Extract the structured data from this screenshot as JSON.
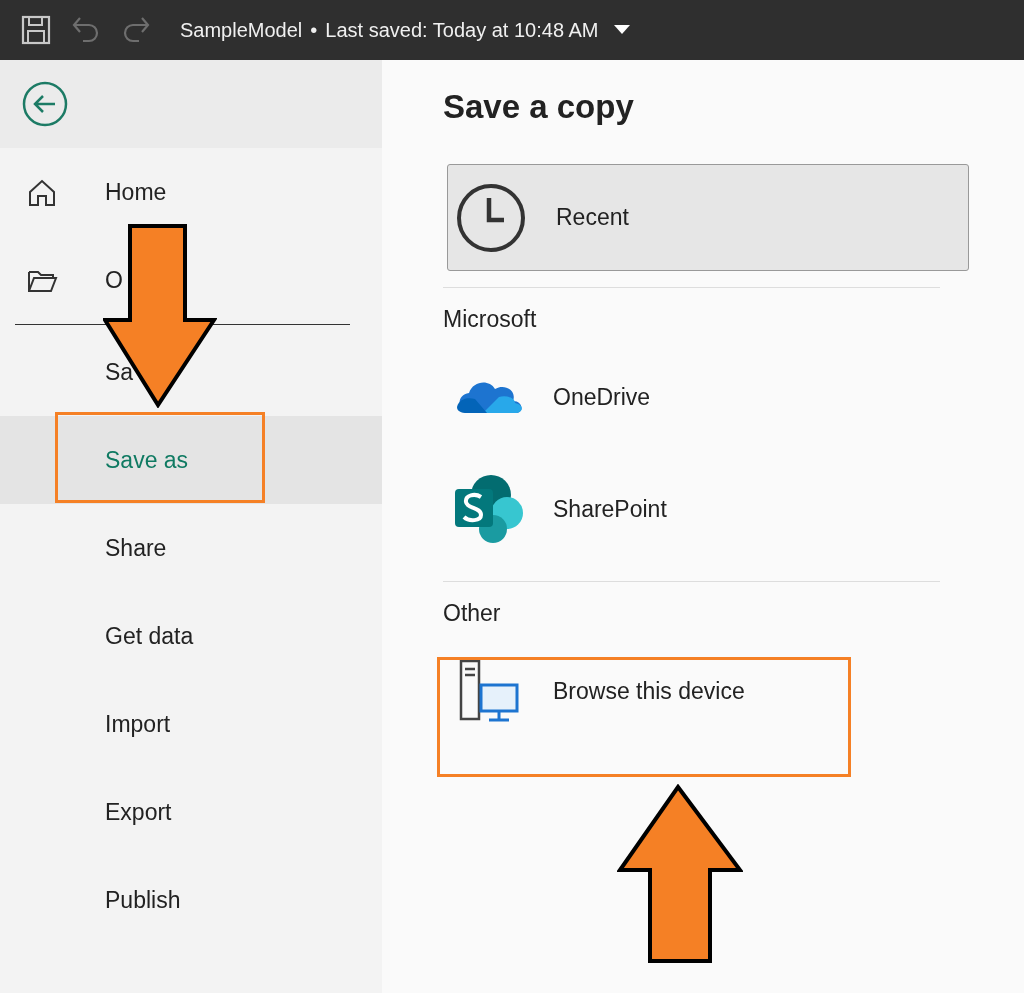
{
  "title_bar": {
    "tools": [
      {
        "kind": "save",
        "disabled": false
      },
      {
        "kind": "undo",
        "disabled": true
      },
      {
        "kind": "redo",
        "disabled": true
      }
    ],
    "file_name": "SampleModel",
    "separator": "•",
    "status": "Last saved: Today at 10:48 AM"
  },
  "sidebar": {
    "primary": [
      {
        "label": "Home",
        "kind": "home",
        "selected": false
      },
      {
        "label": "O",
        "kind": "folder",
        "selected": false
      }
    ],
    "secondary": [
      {
        "label": "Sa",
        "selected": false
      },
      {
        "label": "Save as",
        "selected": true
      },
      {
        "label": "Share",
        "selected": false
      },
      {
        "label": "Get data",
        "selected": false
      },
      {
        "label": "Import",
        "selected": false
      },
      {
        "label": "Export",
        "selected": false
      },
      {
        "label": "Publish",
        "selected": false
      }
    ]
  },
  "content": {
    "heading": "Save a copy",
    "recent": {
      "label": "Recent"
    },
    "sections": [
      {
        "title": "Microsoft",
        "items": [
          {
            "label": "OneDrive",
            "kind": "onedrive"
          },
          {
            "label": "SharePoint",
            "kind": "sharepoint"
          }
        ]
      },
      {
        "title": "Other",
        "items": [
          {
            "label": "Browse this device",
            "kind": "device"
          }
        ]
      }
    ]
  },
  "annotations": [
    {
      "kind": "highlight"
    },
    {
      "kind": "highlight"
    },
    {
      "kind": "arrow-down"
    },
    {
      "kind": "arrow-up"
    }
  ]
}
